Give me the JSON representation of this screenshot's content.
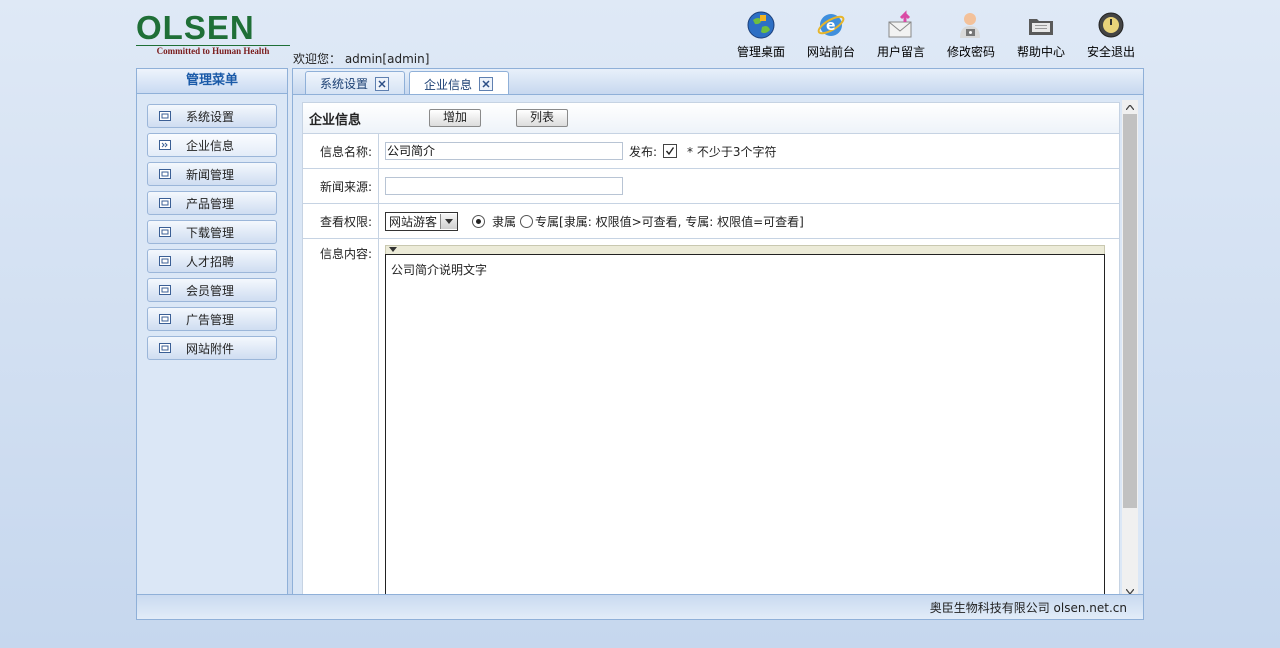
{
  "brand": {
    "logo_text": "OLSEN",
    "tagline": "Committed to Human Health"
  },
  "header": {
    "welcome": "欢迎您： admin[admin]"
  },
  "topnav": [
    {
      "label": "管理桌面",
      "icon": "desktop-globe-icon"
    },
    {
      "label": "网站前台",
      "icon": "ie-browser-icon"
    },
    {
      "label": "用户留言",
      "icon": "mail-arrow-icon"
    },
    {
      "label": "修改密码",
      "icon": "user-lock-icon"
    },
    {
      "label": "帮助中心",
      "icon": "folder-help-icon"
    },
    {
      "label": "安全退出",
      "icon": "power-icon"
    }
  ],
  "sidebar": {
    "title": "管理菜单",
    "items": [
      {
        "label": "系统设置"
      },
      {
        "label": "企业信息",
        "active": true
      },
      {
        "label": "新闻管理"
      },
      {
        "label": "产品管理"
      },
      {
        "label": "下载管理"
      },
      {
        "label": "人才招聘"
      },
      {
        "label": "会员管理"
      },
      {
        "label": "广告管理"
      },
      {
        "label": "网站附件"
      }
    ]
  },
  "tabs": [
    {
      "label": "系统设置"
    },
    {
      "label": "企业信息",
      "active": true
    }
  ],
  "form": {
    "title": "企业信息",
    "add_label": "增加",
    "list_label": "列表",
    "name_label": "信息名称:",
    "name_value": "公司简介",
    "publish_label": "发布:",
    "publish_checked": true,
    "name_hint": "* 不少于3个字符",
    "source_label": "新闻来源:",
    "source_value": "",
    "perm_label": "查看权限:",
    "perm_selected": "网站游客",
    "radio_belong": "隶属",
    "radio_exclusive": "专属",
    "perm_hint": "[隶属: 权限值>可查看, 专属: 权限值=可查看]",
    "content_label": "信息内容:",
    "content_value": "公司简介说明文字"
  },
  "footer": {
    "text": "奥臣生物科技有限公司 olsen.net.cn"
  },
  "colors": {
    "accent": "#1a5aa8",
    "brand_green": "#1f6f37",
    "border": "#8fb0d8"
  }
}
